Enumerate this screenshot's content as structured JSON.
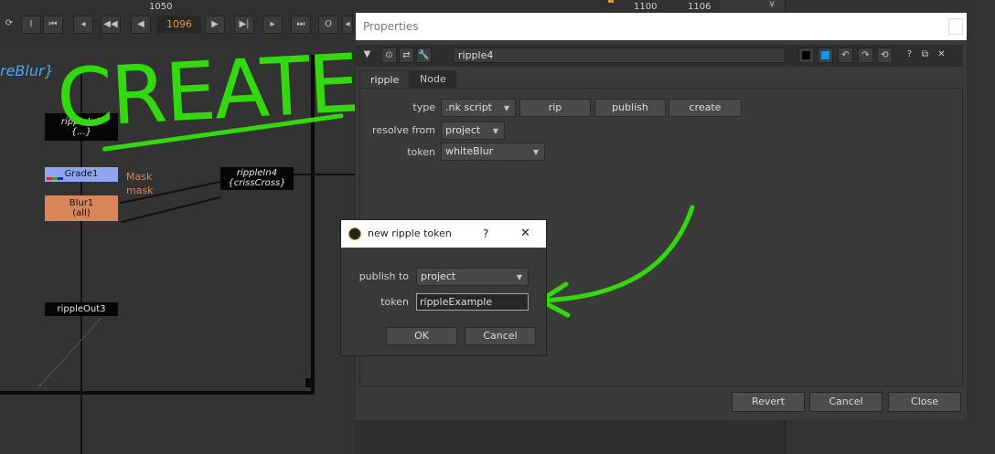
{
  "timeline": {
    "ticks": [
      "1050",
      "1100",
      "1106"
    ],
    "current_frame": "1096",
    "buttons": [
      "I",
      "O"
    ]
  },
  "nodegraph": {
    "backdrop_label": "reBlur}",
    "annotation": "CREATE",
    "nodes": {
      "rippleIn3_line1": "rippleIn3",
      "rippleIn3_line2": "{...}",
      "grade": "Grade1",
      "rippleIn4_line1": "rippleIn4",
      "rippleIn4_line2": "{crissCross}",
      "blur_line1": "Blur1",
      "blur_line2": "(all)",
      "rippleOut": "rippleOut3"
    },
    "mask_labels": [
      "Mask",
      "mask"
    ]
  },
  "properties": {
    "window_title": "Properties",
    "node_name": "ripple4",
    "tabs": [
      "ripple",
      "Node"
    ],
    "type_label": "type",
    "type_value": ".nk script",
    "rip_button": "rip",
    "publish_button": "publish",
    "create_button": "create",
    "resolve_label": "resolve from",
    "resolve_value": "project",
    "token_label": "token",
    "token_value": "whiteBlur",
    "revert_button": "Revert",
    "cancel_button": "Cancel",
    "close_button": "Close"
  },
  "dialog": {
    "title": "new ripple token",
    "help": "?",
    "close": "✕",
    "publish_to_label": "publish to",
    "publish_to_value": "project",
    "token_label": "token",
    "token_value": "rippleExample",
    "ok_button": "OK",
    "cancel_button": "Cancel"
  },
  "colors": {
    "accent_orange": "#e2953a",
    "annotation_green": "#34d80f",
    "grade_node": "#8fa6ef",
    "blur_node": "#d9855a"
  }
}
